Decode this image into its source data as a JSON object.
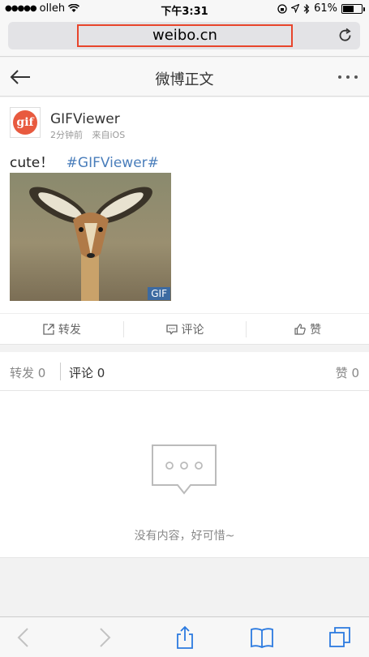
{
  "status": {
    "carrier": "olleh",
    "time": "下午3:31",
    "battery": "61%",
    "battery_level": 0.61
  },
  "browser": {
    "url": "weibo.cn"
  },
  "header": {
    "title": "微博正文"
  },
  "post": {
    "avatar_text": "gif",
    "username": "GIFViewer",
    "time": "2分钟前",
    "source": "来自iOS",
    "text": "cute！",
    "hashtag": "#GIFViewer#",
    "image_badge": "GIF",
    "actions": {
      "repost": "转发",
      "comment": "评论",
      "like": "赞"
    }
  },
  "tabs": {
    "repost": "转发 0",
    "comment": "评论 0",
    "like": "赞 0"
  },
  "empty": {
    "text": "没有内容，好可惜~"
  }
}
